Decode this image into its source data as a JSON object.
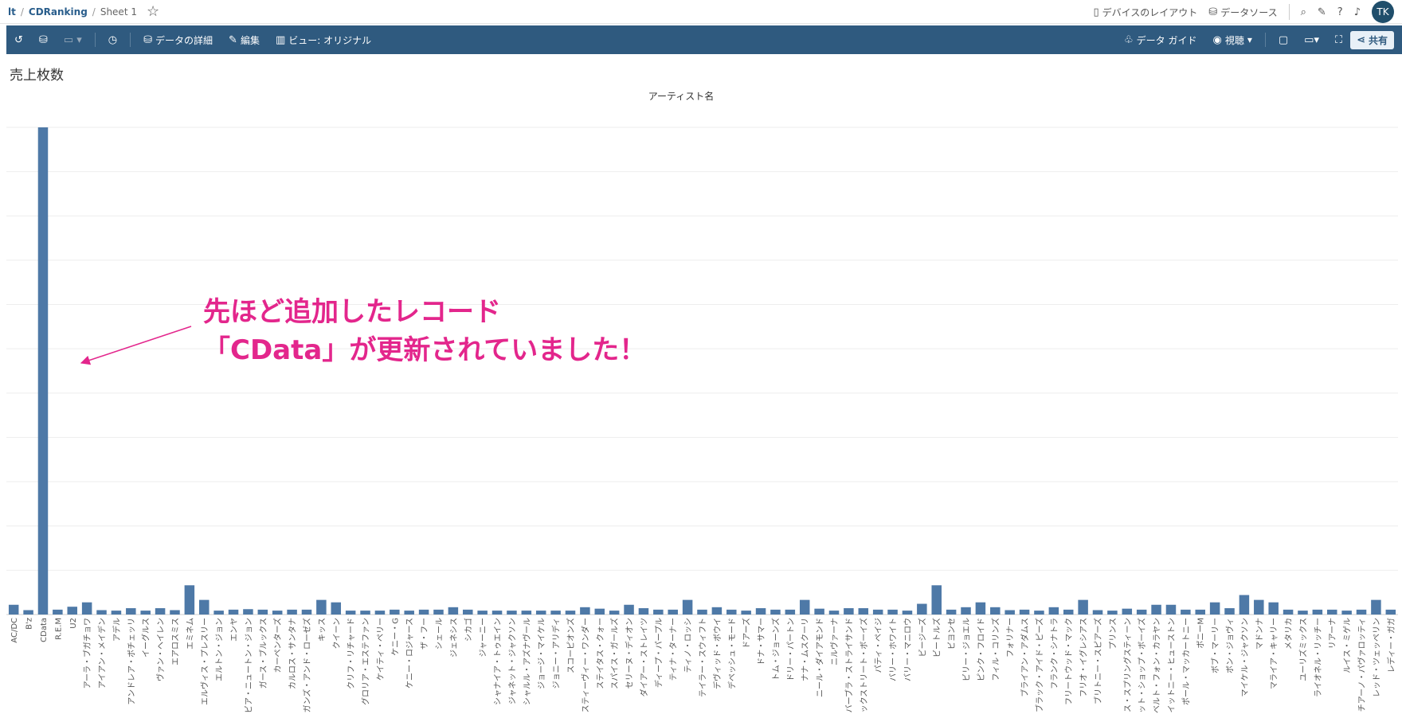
{
  "breadcrumb": {
    "root": "lt",
    "workbook": "CDRanking",
    "sheet": "Sheet 1"
  },
  "topbar": {
    "device_layout": "デバイスのレイアウト",
    "data_source": "データソース",
    "avatar": "TK"
  },
  "toolbar": {
    "data_details": "データの詳細",
    "edit": "編集",
    "view": "ビュー: オリジナル",
    "data_guide": "データ ガイド",
    "watch": "視聴",
    "share": "共有"
  },
  "icons": [
    "back-icon",
    "datasource-icon",
    "toggle-icon",
    "performance-icon",
    "cylinder-icon",
    "edit-icon",
    "view-icon",
    "data-guide-icon",
    "eye-icon",
    "comment-icon",
    "present-icon",
    "fullscreen-icon",
    "share-icon",
    "search-icon",
    "notes-icon",
    "help-icon",
    "bell-icon",
    "star-icon",
    "device-icon"
  ],
  "colors": {
    "toolbar_bg": "#2f5a7f",
    "bar": "#4e79a7",
    "annotation": "#e3268c"
  },
  "sheet_title": "売上枚数",
  "annotation": {
    "line1": "先ほど追加したレコード",
    "line2": "「CData」が更新されていました！"
  },
  "chart_data": {
    "type": "bar",
    "xlabel": "アーティスト名",
    "grid": true,
    "categories": [
      "AC/DC",
      "B'z",
      "CData",
      "R.E.M",
      "U2",
      "アーラ・ブガチョワ",
      "アイアン・メイデン",
      "アデル",
      "アンドレア・ボチェッリ",
      "イーグルス",
      "ヴァン・ヘイレン",
      "エアロスミス",
      "エミネム",
      "エルヴィス・プレスリー",
      "エルトン・ジョン",
      "エンヤ",
      "オリビア・ニュートン・ジョン",
      "ガース・ブルックス",
      "カーペンターズ",
      "カルロス・サンタナ",
      "ガンズ・アンド・ローゼズ",
      "キッス",
      "クイーン",
      "クリフ・リチャード",
      "グロリア・エステファン",
      "ケイティ・ペリー",
      "ケニー・G",
      "ケニー・ロジャース",
      "ザ・フー",
      "シェール",
      "ジェネシス",
      "シカゴ",
      "ジャーニー",
      "シャナイア・トゥエイン",
      "ジャネット・ジャクソン",
      "シャルル・アズナヴール",
      "ジョージ・マイケル",
      "ジョニー・アリディ",
      "スコーピオンズ",
      "スティーヴィー・ワンダー",
      "ステイタス・クォー",
      "スパイス・ガールズ",
      "セリーヌ・ディオン",
      "ダイアー・ストレイツ",
      "ディープ・パープル",
      "ティナ・ターナー",
      "ティノ・ロッシ",
      "テイラー・スウィフト",
      "デヴィッド・ボウイ",
      "デペッシュ・モード",
      "ドアーズ",
      "ドナ・サマー",
      "トム・ジョーンズ",
      "ドリー・パートン",
      "ナナ・ムスクーリ",
      "ニール・ダイアモンド",
      "ニルヴァーナ",
      "バーブラ・ストライサンド",
      "バックストリート・ボーイズ",
      "パティ・ペイジ",
      "バリー・ホワイト",
      "バリー・マニロウ",
      "ビージーズ",
      "ビートルズ",
      "ビヨンセ",
      "ビリー・ジョエル",
      "ピンク・フロイド",
      "フィル・コリンズ",
      "フォリナー",
      "ブライアン・アダムス",
      "ブラック・アイド・ピーズ",
      "フランク・シナトラ",
      "フリートウッド・マック",
      "フリオ・イグレシアス",
      "ブリトニー・スピアーズ",
      "プリンス",
      "ブルース・スプリングスティーン",
      "ペット・ショップ・ボーイズ",
      "ヘルベルト・フォン・カラヤン",
      "ホイットニー・ヒューストン",
      "ポール・マッカートニー",
      "ボニーM",
      "ボブ・マーリー",
      "ボン・ジョヴィ",
      "マイケル・ジャクソン",
      "マドンナ",
      "マライア・キャリー",
      "メタリカ",
      "ユーリズミックス",
      "ライオネル・リッチー",
      "リアーナ",
      "ルイス・ミゲル",
      "レチアーノ・パヴァロッティ",
      "レッド・ツェッペリン",
      "レディー・ガガ"
    ],
    "values": [
      2.0,
      0.9,
      100,
      1.0,
      1.6,
      2.5,
      0.9,
      0.8,
      1.3,
      0.8,
      1.3,
      0.9,
      6.0,
      3.0,
      0.8,
      1.0,
      1.1,
      1.0,
      0.8,
      1.0,
      1.0,
      3.0,
      2.5,
      0.8,
      0.8,
      0.8,
      1.0,
      0.8,
      1.0,
      1.0,
      1.5,
      1.0,
      0.8,
      0.8,
      0.8,
      0.8,
      0.8,
      0.8,
      0.8,
      1.5,
      1.2,
      0.8,
      2.0,
      1.3,
      1.0,
      1.0,
      3.0,
      1.0,
      1.5,
      1.0,
      0.8,
      1.3,
      1.0,
      1.0,
      3.0,
      1.2,
      0.8,
      1.3,
      1.3,
      1.0,
      1.0,
      0.8,
      2.2,
      6.0,
      1.0,
      1.5,
      2.5,
      1.5,
      0.9,
      1.0,
      0.8,
      1.5,
      1.0,
      3.0,
      0.9,
      0.8,
      1.2,
      1.0,
      2.0,
      2.0,
      1.0,
      1.0,
      2.5,
      1.3,
      4.0,
      3.0,
      2.5,
      1.0,
      0.8,
      1.0,
      1.0,
      0.8,
      1.0,
      3.0,
      1.0
    ]
  }
}
